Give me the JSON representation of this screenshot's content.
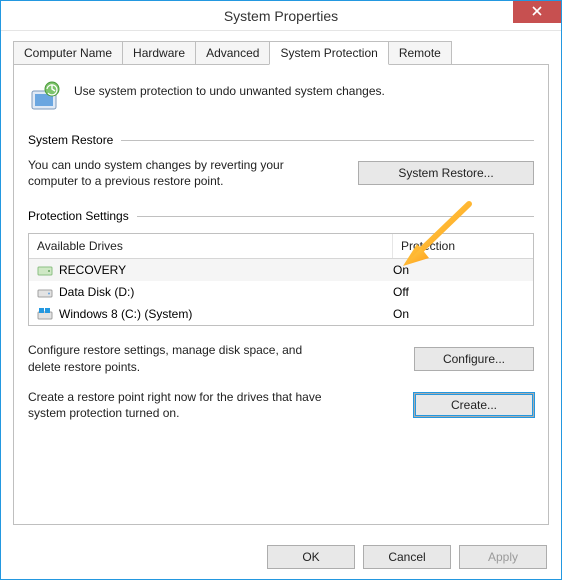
{
  "window": {
    "title": "System Properties"
  },
  "tabs": [
    {
      "label": "Computer Name"
    },
    {
      "label": "Hardware"
    },
    {
      "label": "Advanced"
    },
    {
      "label": "System Protection"
    },
    {
      "label": "Remote"
    }
  ],
  "intro": "Use system protection to undo unwanted system changes.",
  "groups": {
    "restore": {
      "title": "System Restore",
      "text": "You can undo system changes by reverting your computer to a previous restore point.",
      "button": "System Restore..."
    },
    "settings": {
      "title": "Protection Settings",
      "columns": {
        "drive": "Available Drives",
        "protection": "Protection"
      },
      "drives": [
        {
          "name": "RECOVERY",
          "protection": "On",
          "icon": "drive"
        },
        {
          "name": "Data Disk (D:)",
          "protection": "Off",
          "icon": "disk"
        },
        {
          "name": "Windows 8 (C:) (System)",
          "protection": "On",
          "icon": "windows"
        }
      ],
      "configure": {
        "text": "Configure restore settings, manage disk space, and delete restore points.",
        "button": "Configure..."
      },
      "create": {
        "text": "Create a restore point right now for the drives that have system protection turned on.",
        "button": "Create..."
      }
    }
  },
  "footer": {
    "ok": "OK",
    "cancel": "Cancel",
    "apply": "Apply"
  }
}
